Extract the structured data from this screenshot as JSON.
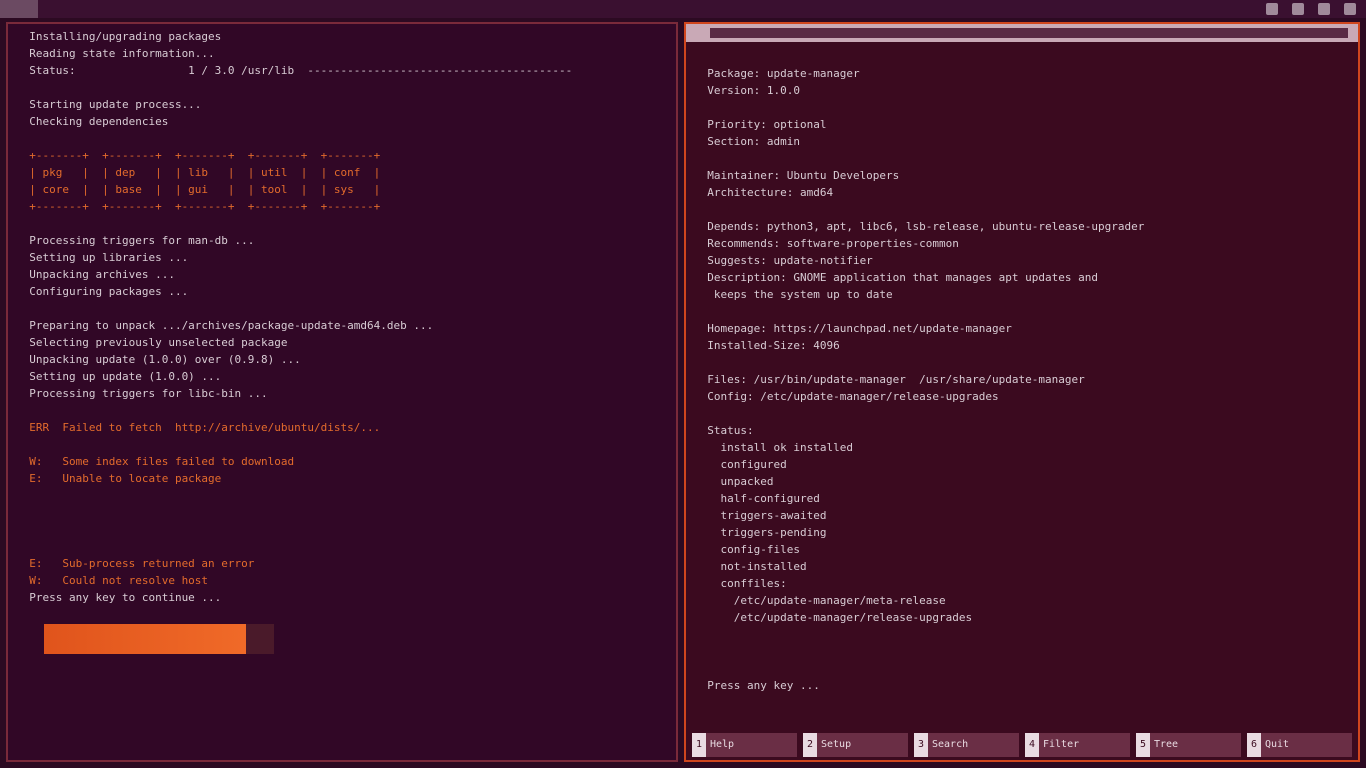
{
  "topbar": {
    "activities": "",
    "clock": "",
    "tray_icons": [
      "network-icon",
      "volume-icon",
      "battery-icon",
      "power-icon"
    ]
  },
  "left_terminal": {
    "lines": [
      "  Installing/upgrading packages",
      "  Reading state information...",
      "  Status:                 1 / 3.0 /usr/lib  ----------------------------------------",
      "",
      "  Starting update process...",
      "  Checking dependencies",
      "",
      "  +-------+  +-------+  +-------+  +-------+  +-------+",
      "  | pkg   |  | dep   |  | lib   |  | util  |  | conf  |",
      "  | core  |  | base  |  | gui   |  | tool  |  | sys   |",
      "  +-------+  +-------+  +-------+  +-------+  +-------+",
      "",
      "  Processing triggers for man-db ...",
      "  Setting up libraries ...",
      "  Unpacking archives ...",
      "  Configuring packages ...",
      "",
      "  Preparing to unpack .../archives/package-update-amd64.deb ...",
      "  Selecting previously unselected package",
      "  Unpacking update (1.0.0) over (0.9.8) ...",
      "  Setting up update (1.0.0) ...",
      "  Processing triggers for libc-bin ...",
      "",
      "  ERR  Failed to fetch  http://archive/ubuntu/dists/...",
      "",
      "  W:   Some index files failed to download",
      "  E:   Unable to locate package",
      "",
      "",
      "",
      "",
      "  E:   Sub-process returned an error",
      "  W:   Could not resolve host",
      "  Press any key to continue ..."
    ],
    "orange_rows": [
      7,
      8,
      9,
      10,
      23,
      25,
      26,
      31,
      32
    ],
    "progress": {
      "label": "",
      "fraction": 0.88
    }
  },
  "right_terminal": {
    "title": "",
    "lines": [
      "  ",
      "  Package: update-manager",
      "  Version: 1.0.0",
      "",
      "  Priority: optional",
      "  Section: admin",
      "",
      "  Maintainer: Ubuntu Developers",
      "  Architecture: amd64",
      "",
      "  Depends: python3, apt, libc6, lsb-release, ubuntu-release-upgrader",
      "  Recommends: software-properties-common",
      "  Suggests: update-notifier",
      "  Description: GNOME application that manages apt updates and",
      "   keeps the system up to date",
      "",
      "  Homepage: https://launchpad.net/update-manager",
      "  Installed-Size: 4096",
      "",
      "  Files: /usr/bin/update-manager  /usr/share/update-manager",
      "  Config: /etc/update-manager/release-upgrades",
      "",
      "  Status:",
      "    install ok installed",
      "    configured",
      "    unpacked",
      "    half-configured",
      "    triggers-awaited",
      "    triggers-pending",
      "    config-files",
      "    not-installed",
      "    conffiles:",
      "      /etc/update-manager/meta-release",
      "      /etc/update-manager/release-upgrades",
      "",
      "  ",
      "",
      "  Press any key ..."
    ],
    "fkeys": [
      {
        "num": "1",
        "label": "Help"
      },
      {
        "num": "2",
        "label": "Setup"
      },
      {
        "num": "3",
        "label": "Search"
      },
      {
        "num": "4",
        "label": "Filter"
      },
      {
        "num": "5",
        "label": "Tree"
      },
      {
        "num": "6",
        "label": "Quit"
      }
    ]
  }
}
